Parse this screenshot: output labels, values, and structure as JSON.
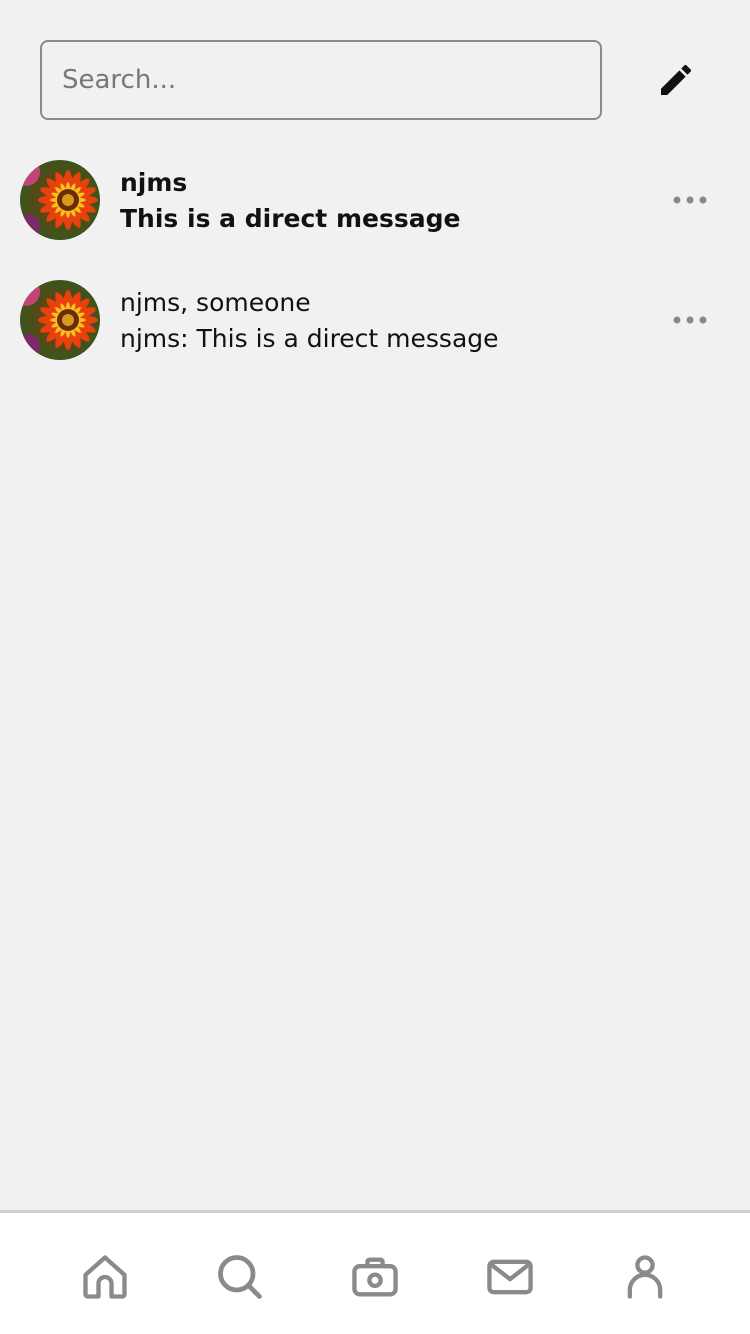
{
  "search": {
    "placeholder": "Search..."
  },
  "header": {
    "compose_icon": "pencil-icon"
  },
  "conversations": [
    {
      "participants": "njms",
      "preview": "This is a direct message",
      "unread": true,
      "avatar_icon": "flower-avatar",
      "menu_icon": "more-horizontal-icon"
    },
    {
      "participants": "njms, someone",
      "preview": "njms: This is a direct message",
      "unread": false,
      "avatar_icon": "flower-avatar",
      "menu_icon": "more-horizontal-icon"
    }
  ],
  "tabbar": {
    "items": [
      {
        "icon": "home-icon"
      },
      {
        "icon": "search-icon"
      },
      {
        "icon": "camera-icon"
      },
      {
        "icon": "mail-icon"
      },
      {
        "icon": "user-icon"
      }
    ]
  },
  "colors": {
    "background": "#f1f1f1",
    "tabbar_background": "#ffffff",
    "tab_icon": "#8a8a8a",
    "text": "#111111",
    "border": "#8a8a8a"
  }
}
